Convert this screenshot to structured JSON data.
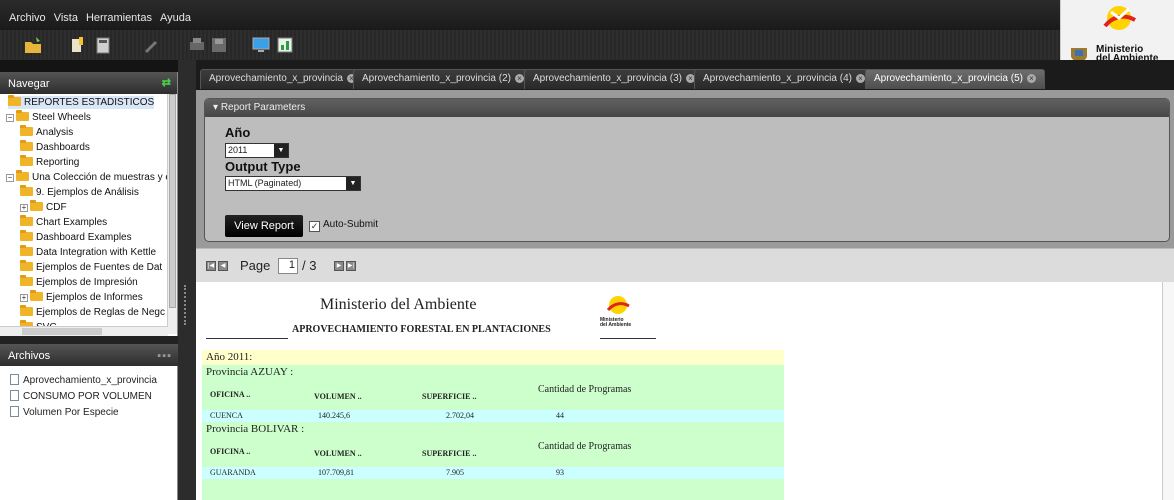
{
  "menubar": {
    "items": [
      "Archivo",
      "Vista",
      "Herramientas",
      "Ayuda"
    ]
  },
  "toolbar": {
    "icons": [
      "open-folder-icon",
      "edit-report-icon",
      "calculator-icon",
      "pencil-icon",
      "print-icon",
      "save-icon",
      "monitor-icon",
      "chart-icon"
    ]
  },
  "brand": {
    "ministry_line1": "Ministerio",
    "ministry_line2": "del Ambiente"
  },
  "navegar": {
    "title": "Navegar",
    "items": [
      {
        "label": "REPORTES ESTADISTICOS",
        "level": 0,
        "expander": "",
        "selected": true
      },
      {
        "label": "Steel Wheels",
        "level": 0,
        "expander": "−"
      },
      {
        "label": "Analysis",
        "level": 1,
        "expander": ""
      },
      {
        "label": "Dashboards",
        "level": 1,
        "expander": ""
      },
      {
        "label": "Reporting",
        "level": 1,
        "expander": ""
      },
      {
        "label": "Una Colección de muestras y e",
        "level": 0,
        "expander": "−"
      },
      {
        "label": "9. Ejemplos de Análisis",
        "level": 1,
        "expander": ""
      },
      {
        "label": "CDF",
        "level": 1,
        "expander": "+"
      },
      {
        "label": "Chart Examples",
        "level": 1,
        "expander": ""
      },
      {
        "label": "Dashboard Examples",
        "level": 1,
        "expander": ""
      },
      {
        "label": "Data Integration with Kettle",
        "level": 1,
        "expander": ""
      },
      {
        "label": "Ejemplos de Fuentes de Dat",
        "level": 1,
        "expander": ""
      },
      {
        "label": "Ejemplos de Impresión",
        "level": 1,
        "expander": ""
      },
      {
        "label": "Ejemplos de Informes",
        "level": 1,
        "expander": "+"
      },
      {
        "label": "Ejemplos de Reglas de Negc",
        "level": 1,
        "expander": ""
      },
      {
        "label": "SVG",
        "level": 1,
        "expander": ""
      }
    ]
  },
  "archivos": {
    "title": "Archivos",
    "items": [
      "Aprovechamiento_x_provincia",
      "CONSUMO POR VOLUMEN",
      "Volumen Por Especie"
    ]
  },
  "tabs": [
    {
      "label": "Aprovechamiento_x_provincia",
      "active": false
    },
    {
      "label": "Aprovechamiento_x_provincia (2)",
      "active": false
    },
    {
      "label": "Aprovechamiento_x_provincia (3)",
      "active": false
    },
    {
      "label": "Aprovechamiento_x_provincia (4)",
      "active": false
    },
    {
      "label": "Aprovechamiento_x_provincia (5)",
      "active": true
    }
  ],
  "params": {
    "title": "Report Parameters",
    "year_label": "Año",
    "year_value": "2011",
    "output_label": "Output Type",
    "output_value": "HTML (Paginated)",
    "view_button": "View Report",
    "auto_submit": "Auto-Submit",
    "auto_submit_checked": true
  },
  "pager": {
    "label": "Page",
    "current": "1",
    "total": "/ 3"
  },
  "report": {
    "title": "Ministerio del Ambiente",
    "subtitle": "APROVECHAMIENTO FORESTAL EN  PLANTACIONES",
    "logo_text_1": "Ministerio",
    "logo_text_2": "del Ambiente",
    "year_band": "Año 2011:",
    "headers": [
      "OFICINA ..",
      "VOLUMEN ..",
      "SUPERFICIE ..",
      "Cantidad de  Programas"
    ],
    "provinces": [
      {
        "name": "Provincia AZUAY :",
        "oficina": "CUENCA",
        "volumen": "140.245,6",
        "superficie": "2.702,04",
        "programas": "44"
      },
      {
        "name": "Provincia BOLIVAR :",
        "oficina": "GUARANDA",
        "volumen": "107.709,81",
        "superficie": "7.905",
        "programas": "93"
      }
    ]
  }
}
